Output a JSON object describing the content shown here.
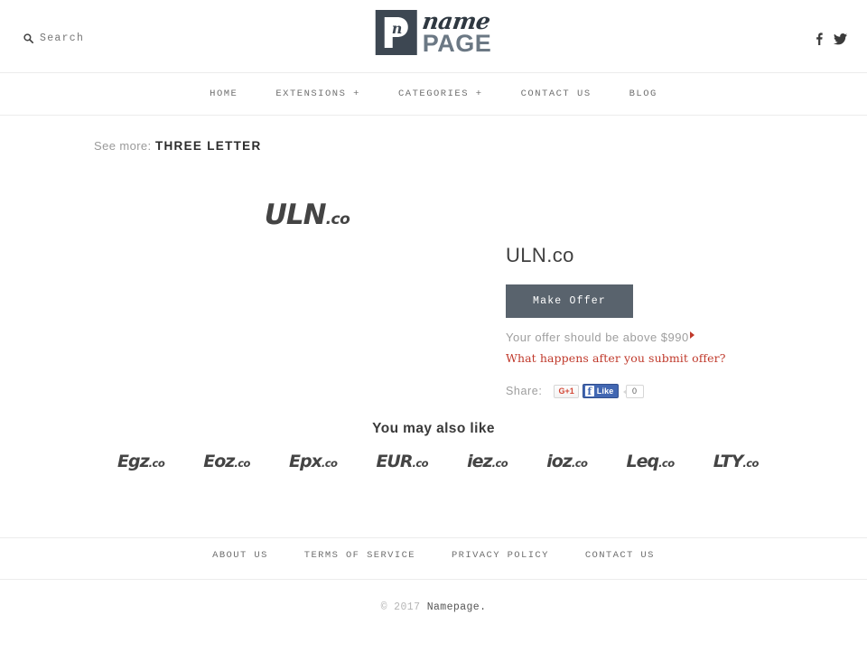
{
  "header": {
    "search": {
      "label": "Search",
      "icon": "search-icon"
    },
    "logo": {
      "mark_letter": "n",
      "word_top": "name",
      "word_bottom": "PAGE"
    },
    "social": [
      {
        "name": "facebook-icon",
        "label": "f"
      },
      {
        "name": "twitter-icon",
        "label": "t"
      }
    ]
  },
  "nav": {
    "items": [
      {
        "label": "HOME"
      },
      {
        "label": "EXTENSIONS +"
      },
      {
        "label": "CATEGORIES +"
      },
      {
        "label": "CONTACT US"
      },
      {
        "label": "BLOG"
      }
    ]
  },
  "see_more": {
    "label": "See more:",
    "link": "THREE LETTER"
  },
  "product": {
    "art_name": "ULN",
    "art_tld": ".co",
    "title": "ULN.co",
    "offer_button": "Make Offer",
    "offer_note": "Your offer should be above $990",
    "offer_minimum": "$990",
    "submit_link": "What happens after you submit offer?",
    "share_label": "Share:",
    "gplus_label": "G+1",
    "fb_like_label": "Like",
    "fb_like_count": "0"
  },
  "also_like": {
    "title": "You may also like",
    "items": [
      {
        "name": "Egz",
        "tld": ".co"
      },
      {
        "name": "Eoz",
        "tld": ".co"
      },
      {
        "name": "Epx",
        "tld": ".co"
      },
      {
        "name": "EUR",
        "tld": ".co"
      },
      {
        "name": "iez",
        "tld": ".co"
      },
      {
        "name": "ioz",
        "tld": ".co"
      },
      {
        "name": "Leq",
        "tld": ".co"
      },
      {
        "name": "LTY",
        "tld": ".co"
      }
    ]
  },
  "footer": {
    "links": [
      {
        "label": "ABOUT US"
      },
      {
        "label": "TERMS OF SERVICE"
      },
      {
        "label": "PRIVACY POLICY"
      },
      {
        "label": "CONTACT US"
      }
    ],
    "copyright_year": "© 2017",
    "copyright_name": "Namepage."
  },
  "colors": {
    "accent_red": "#c0392b",
    "button_slate": "#59636d",
    "logo_dark": "#3d4752",
    "logo_light": "#6b7884",
    "facebook_blue": "#4267b2"
  }
}
